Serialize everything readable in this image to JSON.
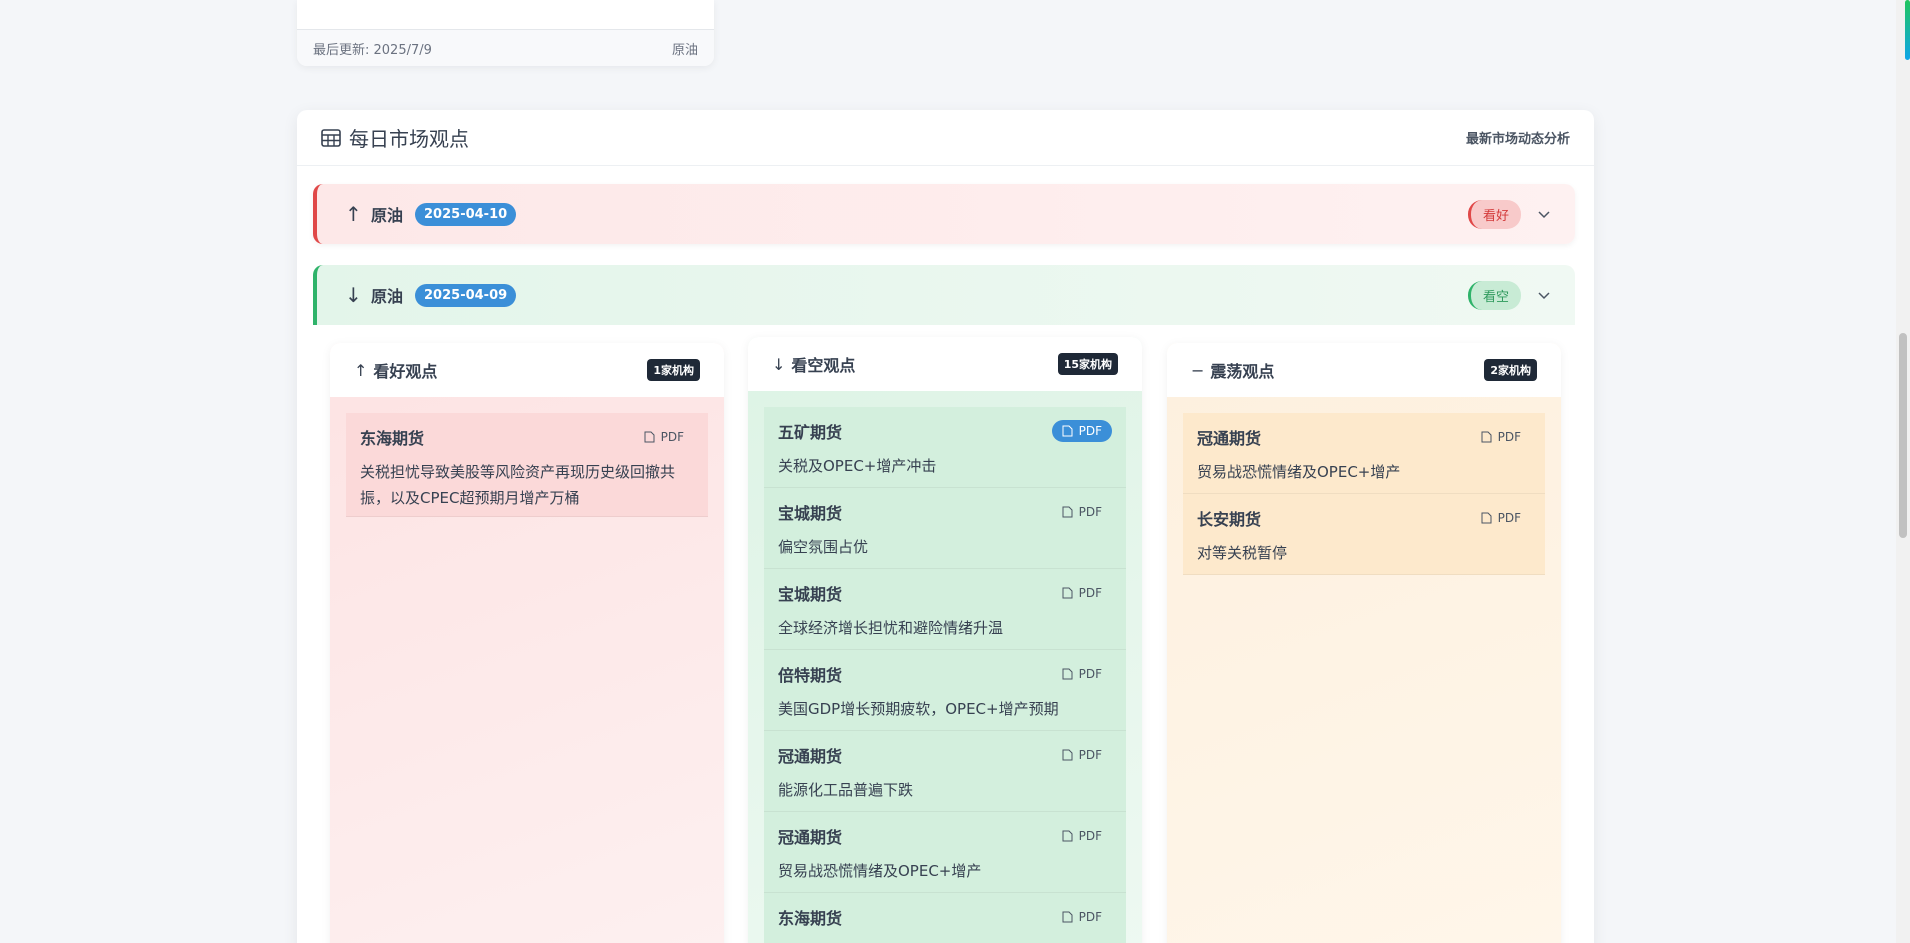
{
  "prev_card": {
    "last_updated": "最后更新: 2025/7/9",
    "category": "原油"
  },
  "panel": {
    "title": "每日市场观点",
    "subtitle": "最新市场动态分析",
    "icon": "table-icon"
  },
  "rows": [
    {
      "arrow": "↑",
      "commodity": "原油",
      "date": "2025-04-10",
      "sentiment": "看好"
    },
    {
      "arrow": "↓",
      "commodity": "原油",
      "date": "2025-04-09",
      "sentiment": "看空"
    }
  ],
  "columns": {
    "bull": {
      "icon": "↑",
      "title": "看好观点",
      "count": "1家机构",
      "items": [
        {
          "org": "东海期货",
          "pdf": "PDF",
          "view": "关税担忧导致美股等风险资产再现历史级回撤共振，以及CPEC超预期月增产万桶"
        }
      ]
    },
    "bear": {
      "icon": "↓",
      "title": "看空观点",
      "count": "15家机构",
      "items": [
        {
          "org": "五矿期货",
          "pdf": "PDF",
          "view": "关税及OPEC+增产冲击"
        },
        {
          "org": "宝城期货",
          "pdf": "PDF",
          "view": "偏空氛围占优"
        },
        {
          "org": "宝城期货",
          "pdf": "PDF",
          "view": "全球经济增长担忧和避险情绪升温"
        },
        {
          "org": "倍特期货",
          "pdf": "PDF",
          "view": "美国GDP增长预期疲软，OPEC+增产预期"
        },
        {
          "org": "冠通期货",
          "pdf": "PDF",
          "view": "能源化工品普遍下跌"
        },
        {
          "org": "冠通期货",
          "pdf": "PDF",
          "view": "贸易战恐慌情绪及OPEC+增产"
        },
        {
          "org": "东海期货",
          "pdf": "PDF",
          "view": ""
        }
      ]
    },
    "range": {
      "icon": "−",
      "title": "震荡观点",
      "count": "2家机构",
      "items": [
        {
          "org": "冠通期货",
          "pdf": "PDF",
          "view": "贸易战恐慌情绪及OPEC+增产"
        },
        {
          "org": "长安期货",
          "pdf": "PDF",
          "view": "对等关税暂停"
        }
      ]
    }
  }
}
